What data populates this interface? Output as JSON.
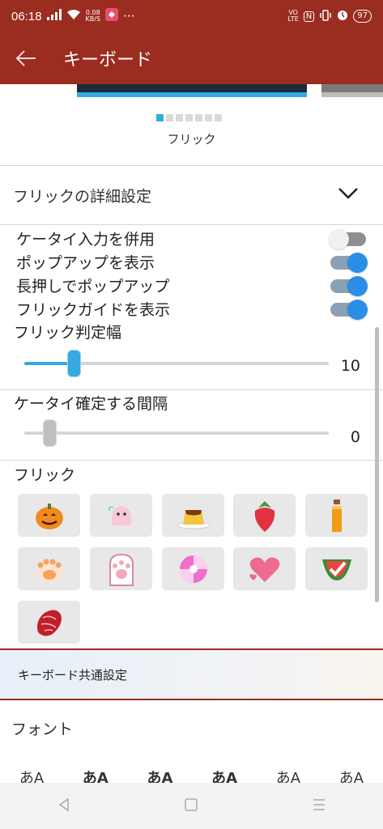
{
  "status": {
    "time": "06:18",
    "net_speed_top": "0.08",
    "net_speed_bottom": "KB/S",
    "dots": "···",
    "volte_top": "VO",
    "volte_bottom": "LTE",
    "nfc": "N",
    "battery": "97"
  },
  "appbar": {
    "title": "キーボード"
  },
  "preview": {
    "caption": "フリック",
    "dot_count": 7,
    "active_dot": 0
  },
  "section": {
    "title": "フリックの詳細設定"
  },
  "toggles": [
    {
      "label": "ケータイ入力を併用",
      "on": false
    },
    {
      "label": "ポップアップを表示",
      "on": true
    },
    {
      "label": "長押しでポップアップ",
      "on": true
    },
    {
      "label": "フリックガイドを表示",
      "on": true
    }
  ],
  "sliders": [
    {
      "label": "フリック判定幅",
      "value": "10",
      "fraction": 0.16
    },
    {
      "label": "ケータイ確定する間隔",
      "value": "0",
      "fraction": 0.0
    }
  ],
  "flick_icons": {
    "title": "フリック",
    "items": [
      "pumpkin",
      "ghost",
      "pudding",
      "strawberry",
      "juice",
      "paw-orange",
      "paw-pink",
      "candy",
      "heart",
      "watermelon",
      "meat"
    ]
  },
  "common": {
    "title": "キーボード共通設定"
  },
  "font": {
    "title": "フォント",
    "samples": [
      "あA",
      "あA",
      "あA",
      "あA",
      "あA",
      "あA"
    ]
  },
  "colors": {
    "accent": "#9b2c20",
    "toggle_on": "#2a8de6",
    "slider": "#36a9e1"
  }
}
